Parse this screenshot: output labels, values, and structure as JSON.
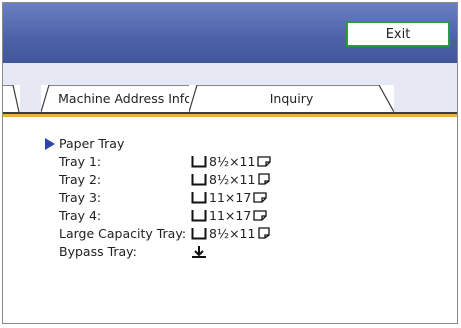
{
  "header": {
    "exit_label": "Exit"
  },
  "tabs": [
    {
      "label": ""
    },
    {
      "label": "Machine Address Info"
    },
    {
      "label": "Inquiry"
    }
  ],
  "section": {
    "title": "Paper Tray",
    "rows": [
      {
        "label": "Tray 1:",
        "paper_size": "8½×11",
        "tray_icon": "tray-icon",
        "orientation_icon": "paper-landscape-icon"
      },
      {
        "label": "Tray 2:",
        "paper_size": "8½×11",
        "tray_icon": "tray-icon",
        "orientation_icon": "paper-portrait-icon"
      },
      {
        "label": "Tray 3:",
        "paper_size": "11×17",
        "tray_icon": "tray-icon",
        "orientation_icon": "paper-landscape-icon"
      },
      {
        "label": "Tray 4:",
        "paper_size": "11×17",
        "tray_icon": "tray-icon",
        "orientation_icon": "paper-landscape-icon"
      },
      {
        "label": "Large Capacity Tray:",
        "paper_size": "8½×11",
        "tray_icon": "tray-icon",
        "orientation_icon": "paper-portrait-icon"
      },
      {
        "label": "Bypass Tray:",
        "paper_size": "",
        "tray_icon": "bypass-tray-icon",
        "orientation_icon": ""
      }
    ]
  },
  "colors": {
    "header_bg": "#4d61a8",
    "exit_border": "#2d9b3a",
    "accent_line": "#e3b73a",
    "arrow": "#2946a8"
  }
}
